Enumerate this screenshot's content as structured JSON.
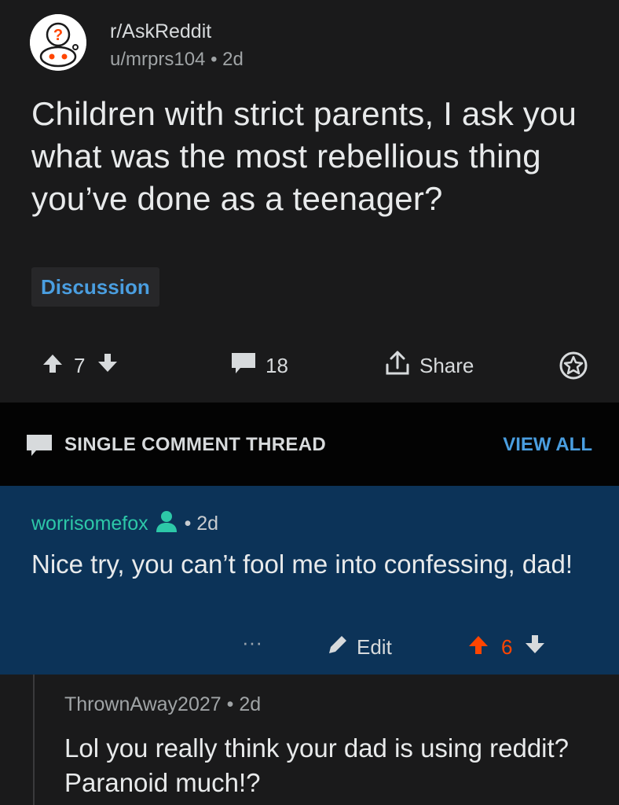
{
  "post": {
    "subreddit": "r/AskReddit",
    "author": "u/mrprs104",
    "separator": "•",
    "age": "2d",
    "title": "Children with strict parents, I ask you what was the most rebellious thing you’ve done as a teenager?",
    "flair": "Discussion",
    "score": "7",
    "comments": "18",
    "share_label": "Share"
  },
  "thread_bar": {
    "label": "SINGLE COMMENT THREAD",
    "view_all": "VIEW ALL"
  },
  "comment": {
    "author": "worrisomefox",
    "separator": "•",
    "age": "2d",
    "text": "Nice try, you can’t fool me into confessing, dad!",
    "more": "···",
    "edit_label": "Edit",
    "score": "6"
  },
  "reply": {
    "author": "ThrownAway2027",
    "separator": "•",
    "age": "2d",
    "text": "Lol you really think your dad is using reddit? Paranoid much!?"
  },
  "colors": {
    "background": "#1a1a1b",
    "thread_bar": "#030303",
    "highlight": "#0c3358",
    "link_blue": "#4a9ee0",
    "username_teal": "#2dc8a8",
    "upvote_orange": "#ff4500"
  },
  "icons": [
    "askreddit-snoo-icon",
    "upvote-arrow-icon",
    "downvote-arrow-icon",
    "comment-bubble-icon",
    "share-icon",
    "award-icon",
    "thread-comment-icon",
    "moderator-person-icon",
    "pencil-icon"
  ]
}
